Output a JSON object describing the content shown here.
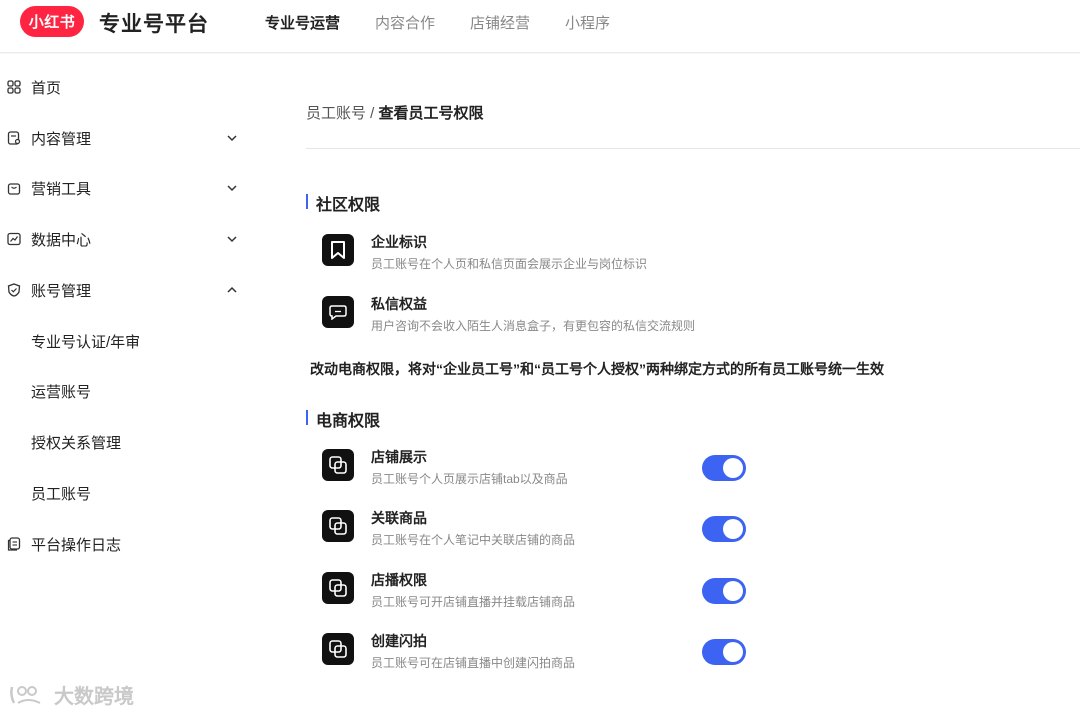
{
  "header": {
    "logo_text": "小红书",
    "brand": "专业号平台",
    "tabs": [
      {
        "label": "专业号运营",
        "active": true
      },
      {
        "label": "内容合作",
        "active": false
      },
      {
        "label": "店铺经营",
        "active": false
      },
      {
        "label": "小程序",
        "active": false
      }
    ]
  },
  "sidebar": {
    "items": [
      {
        "label": "首页",
        "icon": "grid-icon"
      },
      {
        "label": "内容管理",
        "icon": "document-icon",
        "chevron": "down"
      },
      {
        "label": "营销工具",
        "icon": "bag-icon",
        "chevron": "down"
      },
      {
        "label": "数据中心",
        "icon": "chart-icon",
        "chevron": "down"
      },
      {
        "label": "账号管理",
        "icon": "shield-icon",
        "chevron": "up"
      }
    ],
    "sub_items": [
      {
        "label": "专业号认证/年审"
      },
      {
        "label": "运营账号"
      },
      {
        "label": "授权关系管理"
      },
      {
        "label": "员工账号"
      }
    ],
    "log_item": {
      "label": "平台操作日志",
      "icon": "log-icon"
    }
  },
  "watermark": "大数跨境",
  "breadcrumb": {
    "parent": "员工账号",
    "separator": " / ",
    "current": "查看员工号权限"
  },
  "community": {
    "title": "社区权限",
    "perms": [
      {
        "name": "企业标识",
        "desc": "员工账号在个人页和私信页面会展示企业与岗位标识",
        "icon": "bookmark-icon"
      },
      {
        "name": "私信权益",
        "desc": "用户咨询不会收入陌生人消息盒子，有更包容的私信交流规则",
        "icon": "chat-bubble-icon"
      }
    ]
  },
  "notice": "改动电商权限，将对“企业员工号”和“员工号个人授权”两种绑定方式的所有员工账号统一生效",
  "ecommerce": {
    "title": "电商权限",
    "perms": [
      {
        "name": "店铺展示",
        "desc": "员工账号个人页展示店铺tab以及商品",
        "enabled": true
      },
      {
        "name": "关联商品",
        "desc": "员工账号在个人笔记中关联店铺的商品",
        "enabled": true
      },
      {
        "name": "店播权限",
        "desc": "员工账号可开店铺直播并挂载店铺商品",
        "enabled": true
      },
      {
        "name": "创建闪拍",
        "desc": "员工账号可在店铺直播中创建闪拍商品",
        "enabled": true
      }
    ]
  },
  "colors": {
    "brand": "#ff2442",
    "accent": "#3d63f2"
  }
}
